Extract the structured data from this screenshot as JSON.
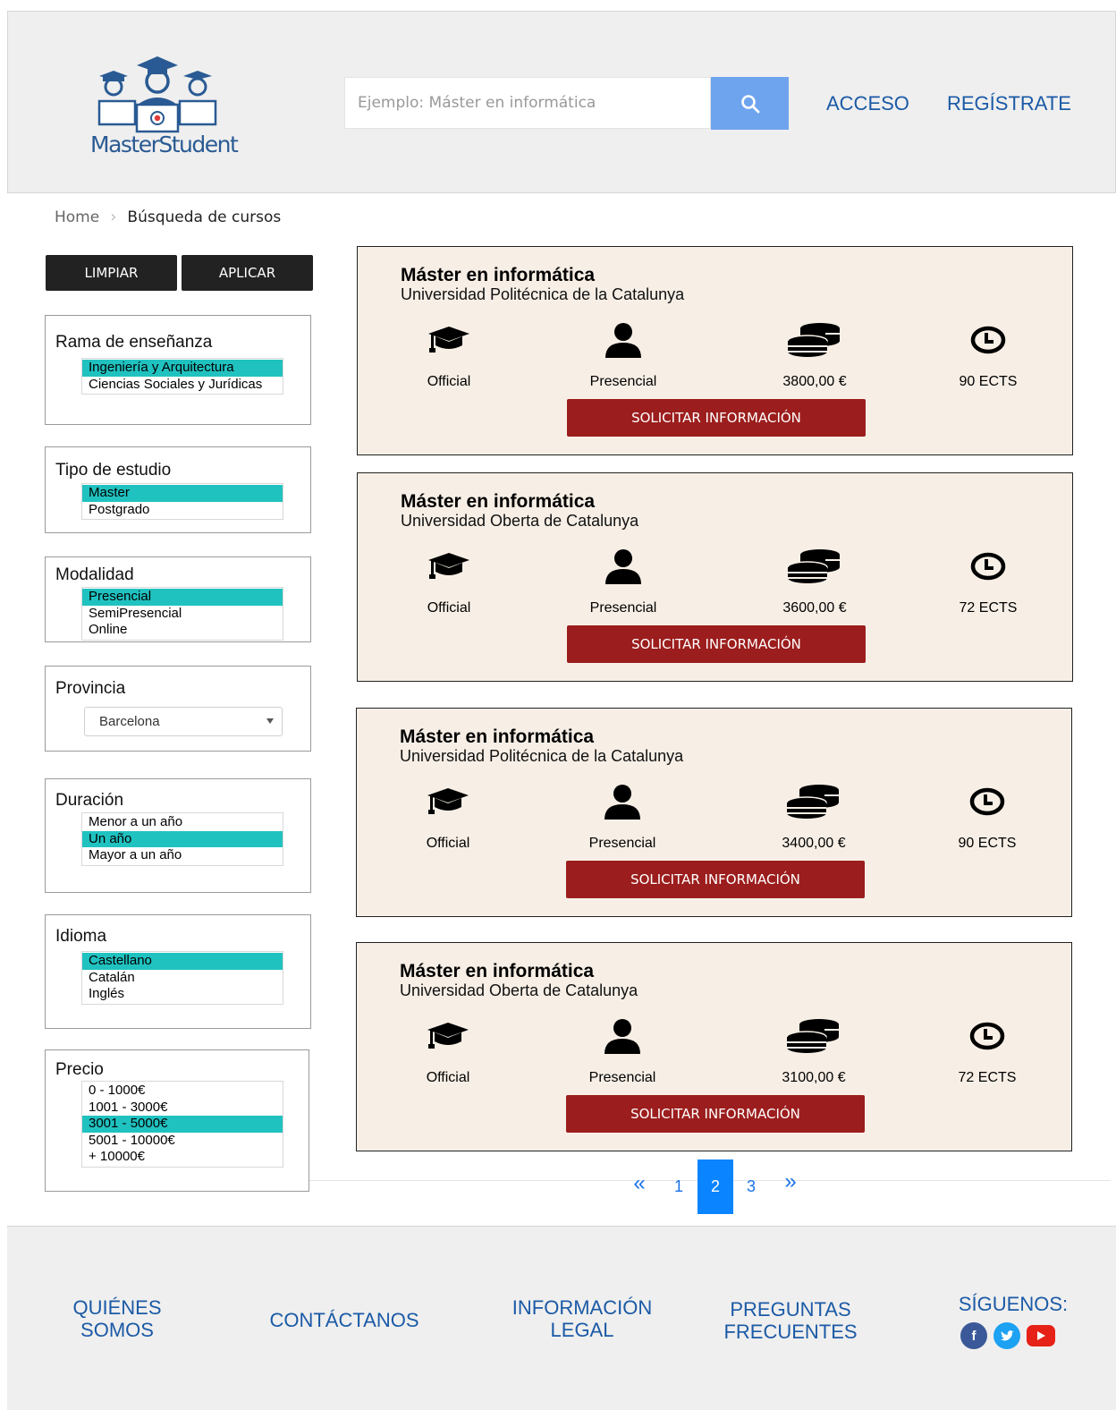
{
  "header": {
    "logo_text": "MasterStudent",
    "search_placeholder": "Ejemplo: Máster en informática",
    "login_label": "ACCESO",
    "register_label": "REGÍSTRATE",
    "accent_color": "#6ea4ee"
  },
  "breadcrumb": {
    "home": "Home",
    "current": "Búsqueda de cursos"
  },
  "sidebar": {
    "clear_label": "LIMPIAR",
    "apply_label": "APLICAR",
    "filters": {
      "rama": {
        "title": "Rama de enseñanza",
        "options": [
          "Ingeniería y Arquitectura",
          "Ciencias Sociales y Jurídicas"
        ],
        "selected": "Ingeniería y Arquitectura"
      },
      "tipo": {
        "title": "Tipo de estudio",
        "options": [
          "Master",
          "Postgrado"
        ],
        "selected": "Master"
      },
      "modalidad": {
        "title": "Modalidad",
        "options": [
          "Presencial",
          "SemiPresencial",
          "Online"
        ],
        "selected": "Presencial"
      },
      "provincia": {
        "title": "Provincia",
        "value": "Barcelona"
      },
      "duracion": {
        "title": "Duración",
        "options": [
          "Menor a un año",
          "Un año",
          "Mayor a un año"
        ],
        "selected": "Un año"
      },
      "idioma": {
        "title": "Idioma",
        "options": [
          "Castellano",
          "Catalán",
          "Inglés"
        ],
        "selected": "Castellano"
      },
      "precio": {
        "title": "Precio",
        "options": [
          "0 - 1000€",
          "1001 - 3000€",
          "3001 - 5000€",
          "5001 - 10000€",
          "+ 10000€"
        ],
        "selected": "3001 - 5000€"
      }
    },
    "selected_color": "#20c2c0"
  },
  "results": [
    {
      "title": "Máster en informática",
      "university": "Universidad Politécnica de la Catalunya",
      "type": "Official",
      "mode": "Presencial",
      "price": "3800,00 €",
      "credits": "90 ECTS",
      "cta": "SOLICITAR INFORMACIÓN"
    },
    {
      "title": "Máster en informática",
      "university": "Universidad Oberta de Catalunya",
      "type": "Official",
      "mode": "Presencial",
      "price": "3600,00 €",
      "credits": "72 ECTS",
      "cta": "SOLICITAR INFORMACIÓN"
    },
    {
      "title": "Máster en informática",
      "university": "Universidad Politécnica de la Catalunya",
      "type": "Official",
      "mode": "Presencial",
      "price": "3400,00 €",
      "credits": "90 ECTS",
      "cta": "SOLICITAR INFORMACIÓN"
    },
    {
      "title": "Máster en informática",
      "university": "Universidad Oberta de Catalunya",
      "type": "Official",
      "mode": "Presencial",
      "price": "3100,00 €",
      "credits": "72 ECTS",
      "cta": "SOLICITAR INFORMACIÓN"
    }
  ],
  "pagination": {
    "prev": "«",
    "next": "»",
    "pages": [
      "1",
      "2",
      "3"
    ],
    "current": "2"
  },
  "footer": {
    "about": "QUIÉNES SOMOS",
    "contact": "CONTÁCTANOS",
    "legal": "INFORMACIÓN LEGAL",
    "faq": "PREGUNTAS FRECUENTES",
    "follow": "SÍGUENOS:",
    "social_icons": [
      "facebook-icon",
      "twitter-icon",
      "youtube-icon"
    ]
  }
}
